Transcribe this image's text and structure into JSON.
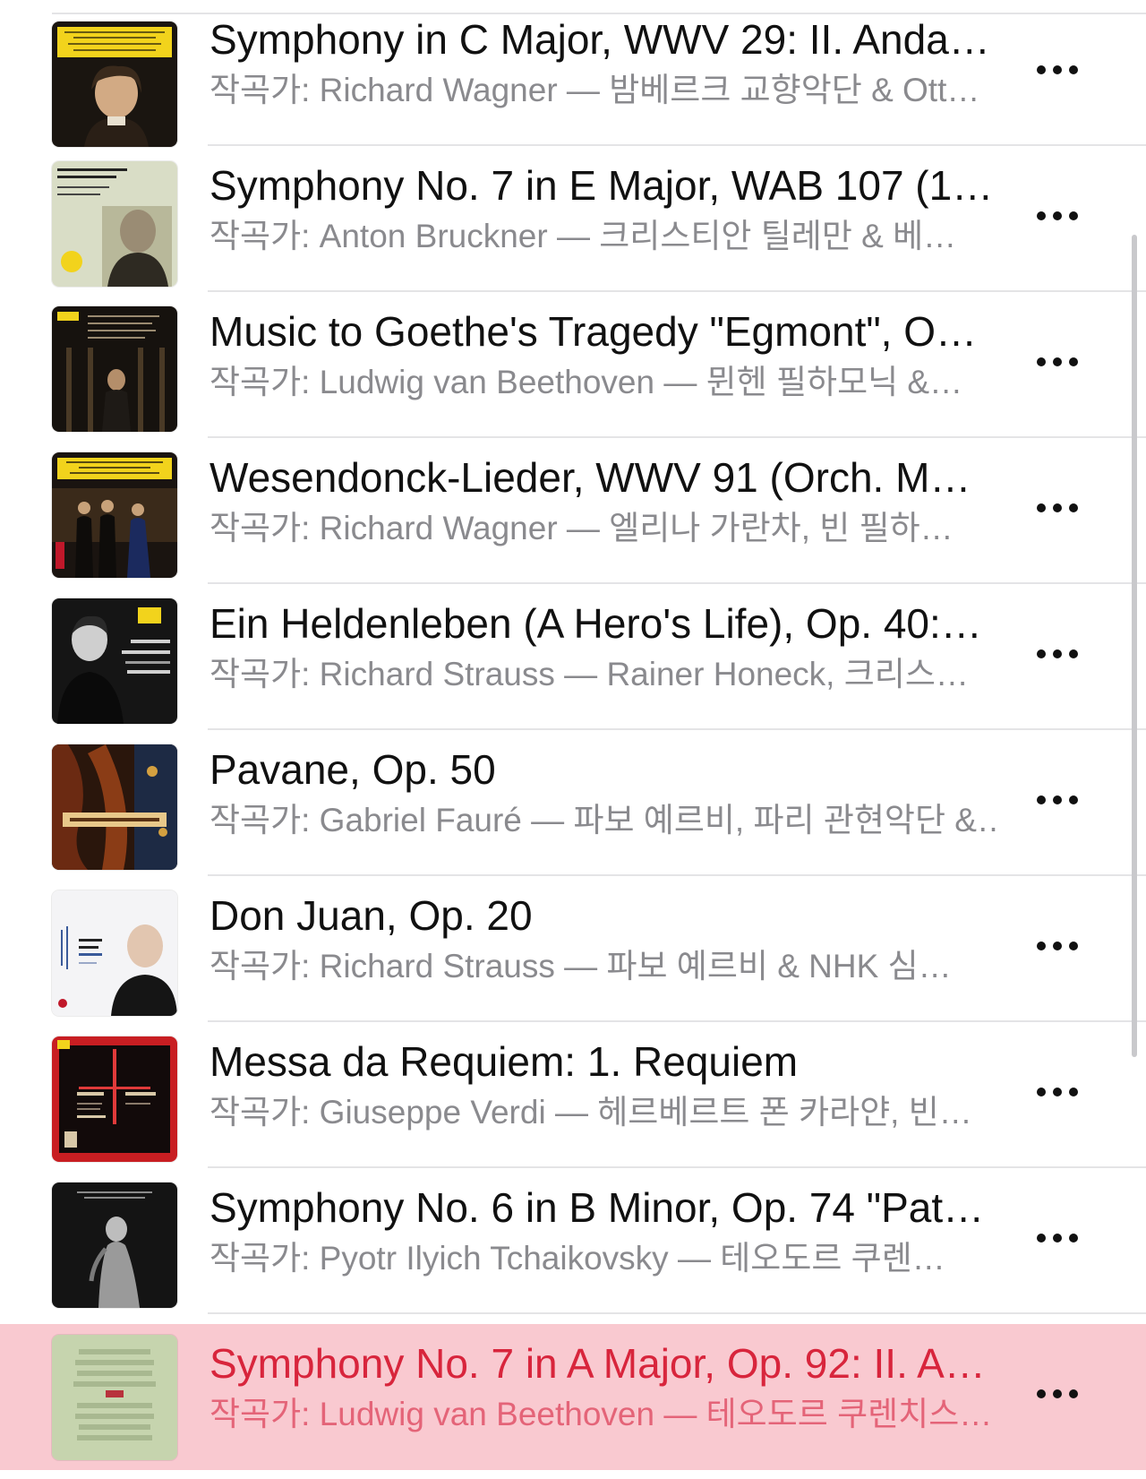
{
  "tracks": [
    {
      "title": "Symphony in C Major, WWV 29: II. Anda…",
      "subtitle": "작곡가: Richard Wagner — 밤베르크 교향악단 & Ott…",
      "art": "wagner-portrait-album-art",
      "art_text": "RICHARD WAGNER · BAMBERGER SYMPHONIKER · OTTO GERDES"
    },
    {
      "title": "Symphony No. 7 in E Major, WAB 107 (1…",
      "subtitle": "작곡가: Anton Bruckner — 크리스티안 틸레만 & 베…",
      "art": "bruckner-portrait-album-art",
      "art_text": "BERLINER PHILHARMONIKER · CHRISTIAN THIELEMANN · ANTON BRUCKNER SYMPHONIE 7"
    },
    {
      "title": "Music to Goethe's Tragedy \"Egmont\", O…",
      "subtitle": "작곡가: Ludwig van Beethoven — 뮌헨 필하모닉 &…",
      "art": "egmont-dark-album-art",
      "art_text": "BRAHMS: Symphonie Nr. 1 · BEETHOVEN: Ouvertüre »Egmont« · Münchner Philharmoniker · Christian Thielemann"
    },
    {
      "title": "Wesendonck-Lieder, WWV 91 (Orch. M…",
      "subtitle": "작곡가: Richard Wagner — 엘리나 가란차, 빈 필하…",
      "art": "salzburg-concert-album-art",
      "art_text": "ELĪNA GARANČA · CHRISTIAN THIELEMANN · LIVE FROM SALZBURG"
    },
    {
      "title": "Ein Heldenleben (A Hero's Life), Op. 40:…",
      "subtitle": "작곡가: Richard Strauss — Rainer Honeck, 크리스…",
      "art": "heldenleben-album-art",
      "art_text": "Strauss · Ein Heldenleben · Wiener Philharmoniker · Thielemann"
    },
    {
      "title": "Pavane, Op. 50",
      "subtitle": "작곡가: Gabriel Fauré — 파보 예르비, 파리 관현악단 &…",
      "art": "chill-autumn-classical-album-art",
      "art_text": "Chill Autumn Classical"
    },
    {
      "title": "Don Juan, Op. 20",
      "subtitle": "작곡가: Richard Strauss — 파보 예르비 & NHK 심…",
      "art": "don-juan-jarvi-album-art",
      "art_text": "Richard Strauss · Paavo Järvi · NHK Symphony Orchestra, Tokyo"
    },
    {
      "title": "Messa da Requiem: 1. Requiem",
      "subtitle": "작곡가: Giuseppe Verdi — 헤르베르트 폰 카라얀, 빈…",
      "art": "verdi-requiem-album-art",
      "art_text": "VERDI · REQUIEM · KARAJAN"
    },
    {
      "title": "Symphony No. 6 in B Minor, Op. 74 \"Pat…",
      "subtitle": "작곡가: Pyotr Ilyich Tchaikovsky — 테오도르 쿠렌…",
      "art": "tchaikovsky-pathetique-album-art",
      "art_text": "TCHAIKOVSKY · TEODOR CURRENTZIS"
    },
    {
      "title": "Symphony No. 7 in A Major, Op. 92: II. A…",
      "subtitle": "작곡가: Ludwig van Beethoven — 테오도르 쿠렌치스…",
      "art": "beethoven-7-currentzis-album-art",
      "art_text": "LUDWIG BEETHOVEN SYMPHONY Nº7 TEODOR CURRENTZIS MUSICAETERNA",
      "playing": true
    }
  ],
  "more_icon": "ellipsis-icon",
  "colors": {
    "playing_bg": "#f9c9d0",
    "playing_text": "#d8253c",
    "subtitle_gray": "#8a8a8e",
    "dg_yellow": "#f2d31c"
  }
}
